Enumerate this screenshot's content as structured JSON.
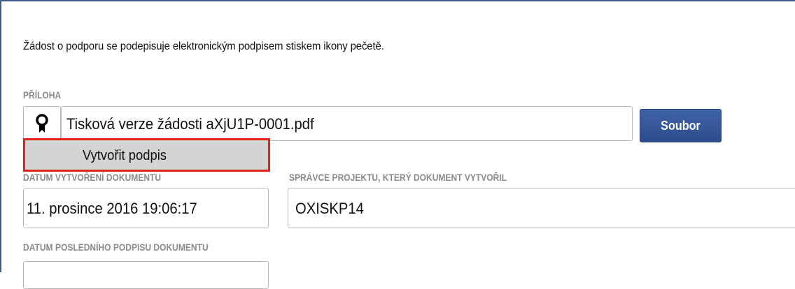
{
  "intro_text": "Žádost o podporu se podepisuje elektronickým podpisem stiskem ikony pečetě.",
  "attachment": {
    "label": "PŘÍLOHA",
    "filename": "Tisková verze žádosti aXjU1P-0001.pdf",
    "seal_icon": "seal-icon",
    "file_button_label": "Soubor"
  },
  "context_menu": {
    "items": [
      "Vytvořit podpis"
    ]
  },
  "created_date": {
    "label": "DATUM VYTVOŘENÍ DOKUMENTU",
    "value": "11. prosince 2016 19:06:17"
  },
  "manager": {
    "label": "SPRÁVCE PROJEKTU, KTERÝ DOKUMENT VYTVOŘIL",
    "value": "OXISKP14"
  },
  "last_signature": {
    "label": "DATUM POSLEDNÍHO PODPISU DOKUMENTU",
    "value": ""
  },
  "colors": {
    "button_bg": "#2e4c8c",
    "highlight_border": "#e2231a",
    "label_gray": "#8a8a8a"
  }
}
